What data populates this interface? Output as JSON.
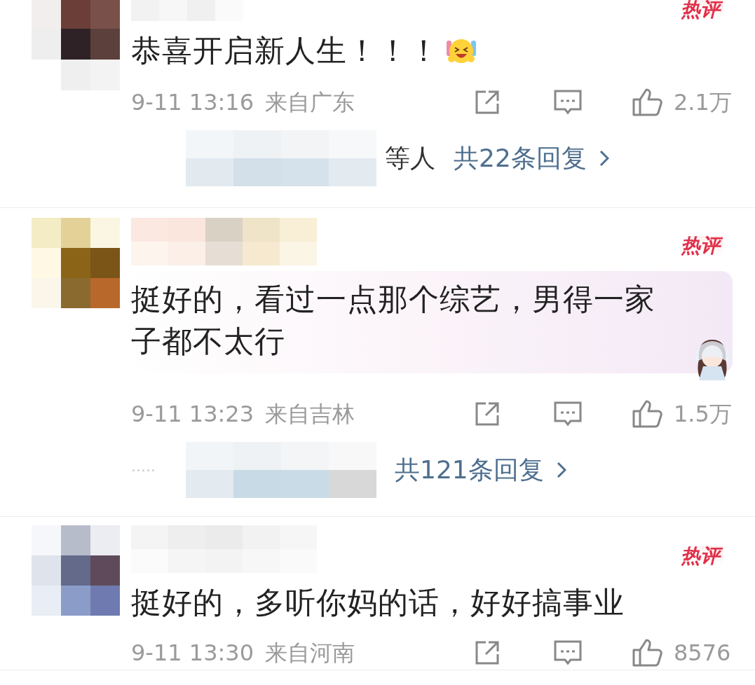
{
  "comments": [
    {
      "kind": "emoji",
      "hot_badge": "热评",
      "text": "恭喜开启新人生！！！",
      "date": "9-11 13:16",
      "location": "来自广东",
      "likes": "2.1万",
      "replies": {
        "names_suffix": "等人",
        "count": "共22条回复"
      }
    },
    {
      "kind": "sticker",
      "hot_badge": "热评",
      "text": "挺好的，看过一点那个综艺，男得一家子都不太行",
      "date": "9-11 13:23",
      "location": "来自吉林",
      "likes": "1.5万",
      "replies": {
        "prefix": "·····",
        "count": "共121条回复"
      }
    },
    {
      "kind": "plain",
      "hot_badge": "热评",
      "text": "挺好的，多听你妈的话，好好搞事业",
      "date": "9-11 13:30",
      "location": "来自河南",
      "likes": "8576"
    }
  ]
}
